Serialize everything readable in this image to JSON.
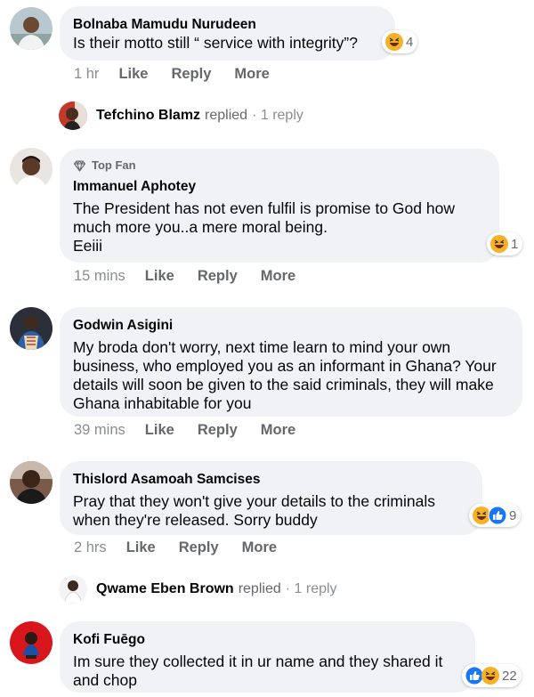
{
  "labels": {
    "like": "Like",
    "reply": "Reply",
    "more": "More",
    "top_fan": "Top Fan",
    "replied": "replied"
  },
  "comments": [
    {
      "author": "Bolnaba Mamudu Nurudeen",
      "text": "Is their motto still “ service with integrity”?",
      "time": "1 hr",
      "reactions": [
        "haha"
      ],
      "reaction_count": "4"
    },
    {
      "author": "Immanuel Aphotey",
      "badge": "Top Fan",
      "text": "The President has not even fulfil is promise to God how much more you..a mere moral being.\nEeiii",
      "time": "15 mins",
      "reactions": [
        "haha"
      ],
      "reaction_count": "1"
    },
    {
      "author": "Godwin Asigini",
      "text": "My broda don't worry, next time learn to mind your own business, who employed you as an informant in Ghana? Your details will soon be given to the said criminals, they will make Ghana inhabitable for you",
      "time": "39 mins"
    },
    {
      "author": "Thislord Asamoah Samcises",
      "text": "Pray that they won't give your details to the criminals when they're released. Sorry buddy",
      "time": "2 hrs",
      "reactions": [
        "haha",
        "like"
      ],
      "reaction_count": "9"
    },
    {
      "author": "Kofi Fuēgo",
      "text": "Im sure they collected it in ur name and they shared it and chop",
      "reactions": [
        "like",
        "haha"
      ],
      "reaction_count": "22"
    }
  ],
  "reply_threads": [
    {
      "name": "Tefchino Blamz",
      "verb": "replied",
      "count": "1 reply"
    },
    {
      "name": "Qwame Eben Brown",
      "verb": "replied",
      "count": "1 reply"
    }
  ],
  "colors": {
    "bubble": "#f0f2f5",
    "meta": "#65676b",
    "like_blue": "#1877f2",
    "haha_yellow": "#f7b125"
  }
}
